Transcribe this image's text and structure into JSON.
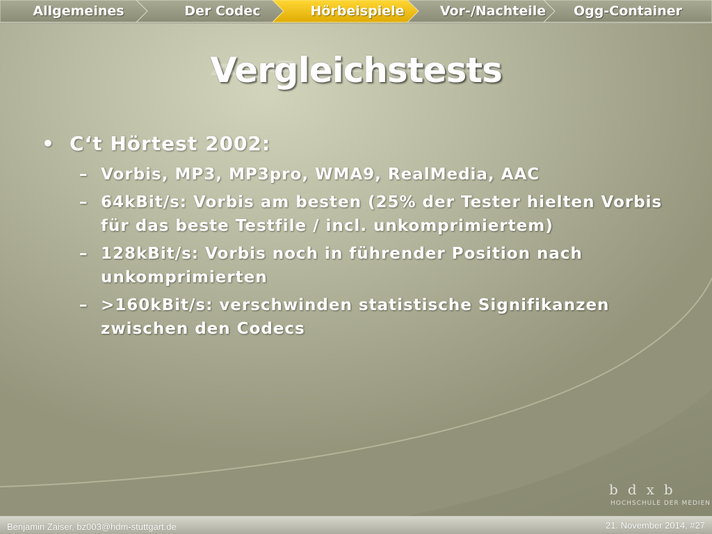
{
  "nav": {
    "items": [
      {
        "label": "Allgemeines",
        "active": false
      },
      {
        "label": "Der Codec",
        "active": false
      },
      {
        "label": "Hörbeispiele",
        "active": true
      },
      {
        "label": "Vor-/Nachteile",
        "active": false
      },
      {
        "label": "Ogg-Container",
        "active": false
      }
    ],
    "active_color": "#f2c314",
    "inactive_color": "#9a9b85"
  },
  "slide": {
    "title": "Vergleichstests",
    "bullet": {
      "marker": "•",
      "text": "C‘t Hörtest 2002:"
    },
    "sub_marker": "–",
    "sub_items": [
      "Vorbis, MP3, MP3pro, WMA9, RealMedia, AAC",
      "64kBit/s: Vorbis am besten (25% der Tester hielten Vorbis für das beste Testfile / incl. unkomprimiertem)",
      "128kBit/s: Vorbis noch in führender Position nach unkomprimierten",
      ">160kBit/s: verschwinden statistische Signifikanzen zwischen den Codecs"
    ]
  },
  "logo": {
    "letters": "bdxb",
    "subtitle": "HOCHSCHULE DER MEDIEN"
  },
  "footer": {
    "author": "Benjamin Zaiser, bz003@hdm-stuttgart.de",
    "date_slide": "21. November 2014, #27"
  }
}
